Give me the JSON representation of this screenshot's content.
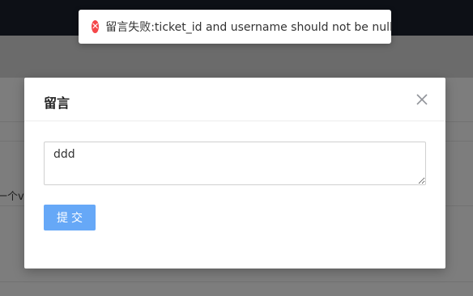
{
  "background": {
    "partial_text": "一个v"
  },
  "toast": {
    "icon": "error-circle-icon",
    "message": "留言失败:ticket_id and username should not be null",
    "color": "#f5474a"
  },
  "modal": {
    "title": "留言",
    "close_icon": "close-icon",
    "textarea_value": "ddd",
    "submit_label": "提交",
    "submit_color": "#66a8f7"
  }
}
